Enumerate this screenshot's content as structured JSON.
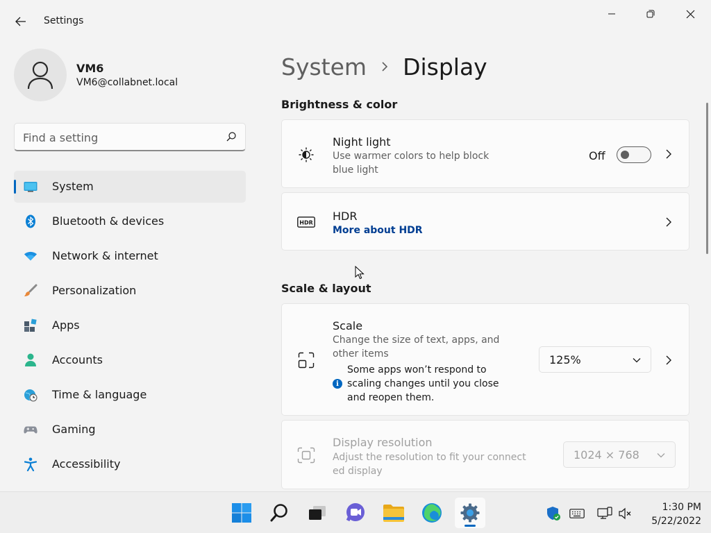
{
  "app": {
    "title": "Settings"
  },
  "user": {
    "name": "VM6",
    "email": "VM6@collabnet.local"
  },
  "search": {
    "placeholder": "Find a setting"
  },
  "nav": {
    "items": [
      {
        "label": "System",
        "icon": "monitor-icon",
        "active": true
      },
      {
        "label": "Bluetooth & devices",
        "icon": "bluetooth-icon"
      },
      {
        "label": "Network & internet",
        "icon": "wifi-icon"
      },
      {
        "label": "Personalization",
        "icon": "brush-icon"
      },
      {
        "label": "Apps",
        "icon": "apps-icon"
      },
      {
        "label": "Accounts",
        "icon": "account-icon"
      },
      {
        "label": "Time & language",
        "icon": "globe-clock-icon"
      },
      {
        "label": "Gaming",
        "icon": "gamepad-icon"
      },
      {
        "label": "Accessibility",
        "icon": "accessibility-icon"
      }
    ]
  },
  "breadcrumb": {
    "parent": "System",
    "current": "Display"
  },
  "sections": {
    "brightness": "Brightness & color",
    "scale_layout": "Scale & layout"
  },
  "night_light": {
    "title": "Night light",
    "desc": "Use warmer colors to help block blue light",
    "state_label": "Off",
    "on": false
  },
  "hdr": {
    "title": "HDR",
    "link": "More about HDR"
  },
  "scale": {
    "title": "Scale",
    "desc": "Change the size of text, apps, and other items",
    "note": "Some apps won’t respond to scaling changes until you close and reopen them.",
    "value": "125%"
  },
  "resolution": {
    "title": "Display resolution",
    "desc": "Adjust the resolution to fit your connected display",
    "value": "1024 × 768"
  },
  "taskbar": {
    "time": "1:30 PM",
    "date": "5/22/2022"
  },
  "colors": {
    "accent": "#0067c0",
    "link": "#003e92"
  }
}
